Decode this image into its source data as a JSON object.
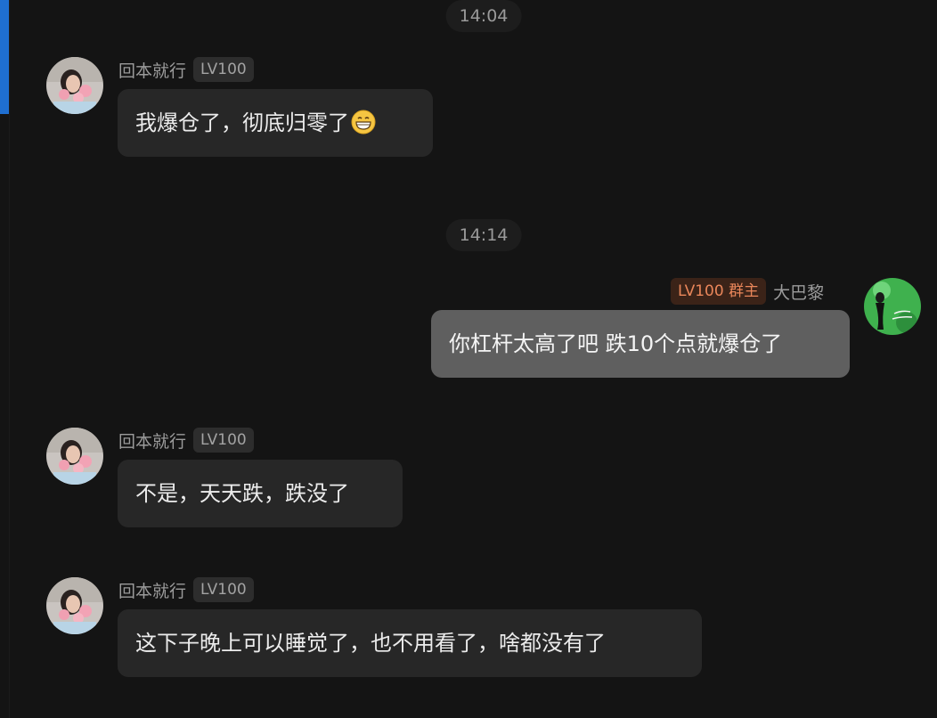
{
  "theme": {
    "background": "#141414",
    "accent": "#1f6fd1",
    "bubble_other": "#272727",
    "bubble_mine": "#5f5f5f",
    "owner_badge_color": "#e9865a"
  },
  "timestamps": [
    "14:04",
    "14:14"
  ],
  "messages": [
    {
      "sender": "回本就行",
      "level": "LV100",
      "text": "我爆仓了，彻底归零了",
      "emoji": "grinning-face-emoji",
      "mine": false
    },
    {
      "sender": "大巴黎",
      "level": "LV100 群主",
      "text": "你杠杆太高了吧 跌10个点就爆仓了",
      "mine": true
    },
    {
      "sender": "回本就行",
      "level": "LV100",
      "text": "不是，天天跌，跌没了",
      "mine": false
    },
    {
      "sender": "回本就行",
      "level": "LV100",
      "text": "这下子晚上可以睡觉了，也不用看了，啥都没有了",
      "mine": false
    }
  ]
}
